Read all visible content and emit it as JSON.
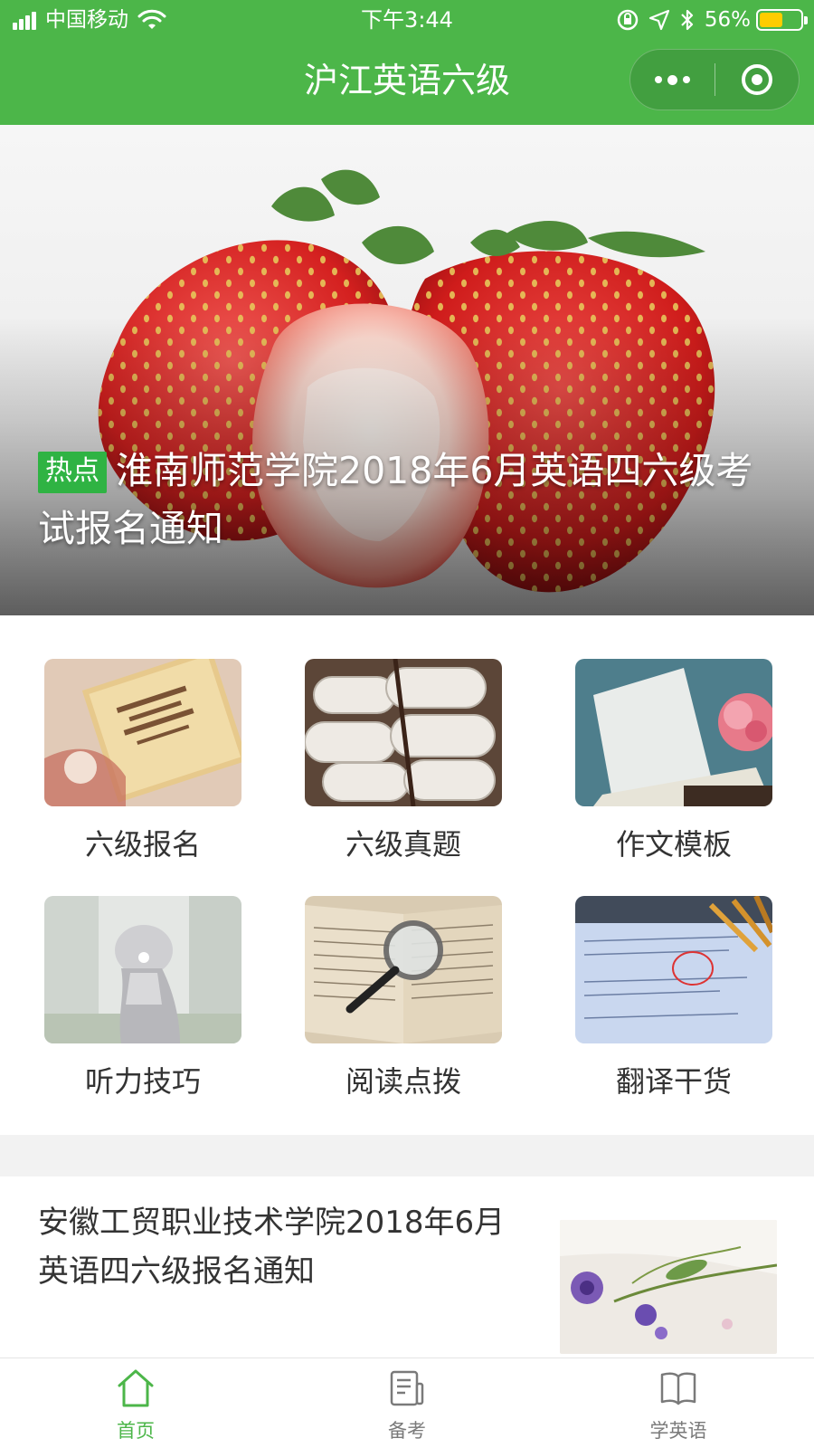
{
  "status_bar": {
    "carrier": "中国移动",
    "time": "下午3:44",
    "battery_percent": "56%",
    "battery_level": 0.56,
    "icons": [
      "signal-icon",
      "wifi-icon",
      "orientation-lock-icon",
      "location-icon",
      "bluetooth-icon",
      "battery-icon"
    ]
  },
  "nav": {
    "title": "沪江英语六级",
    "menu_icon": "more-dots-icon",
    "close_icon": "target-close-icon"
  },
  "banner": {
    "tag": "热点",
    "title": "淮南师范学院2018年6月英语四六级考试报名通知"
  },
  "categories": [
    {
      "label": "六级报名"
    },
    {
      "label": "六级真题"
    },
    {
      "label": "作文模板"
    },
    {
      "label": "听力技巧"
    },
    {
      "label": "阅读点拨"
    },
    {
      "label": "翻译干货"
    }
  ],
  "article": {
    "title": "安徽工贸职业技术学院2018年6月英语四六级报名通知"
  },
  "tabbar": {
    "tabs": [
      {
        "label": "首页",
        "icon": "home-icon",
        "active": true
      },
      {
        "label": "备考",
        "icon": "notebook-icon",
        "active": false
      },
      {
        "label": "学英语",
        "icon": "book-icon",
        "active": false
      }
    ]
  },
  "colors": {
    "brand_green": "#4cb649",
    "tag_green": "#2fb343",
    "battery_yellow": "#ffcc00"
  }
}
